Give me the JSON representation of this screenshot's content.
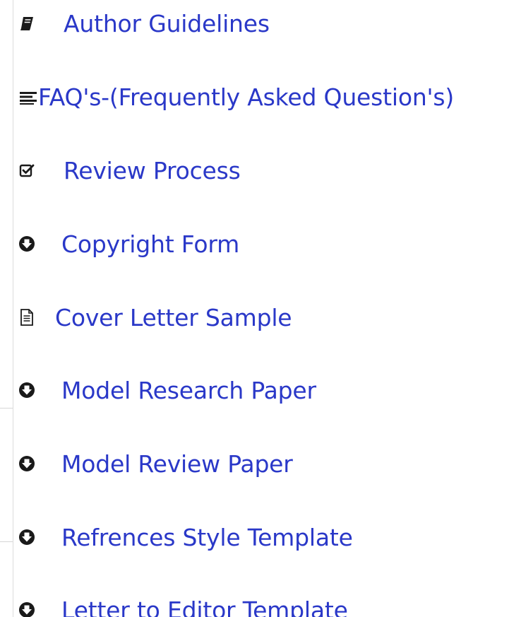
{
  "menu": {
    "items": [
      {
        "label": "Author Guidelines",
        "icon": "book-icon"
      },
      {
        "label": "FAQ's-(Frequently Asked Question's)",
        "icon": "list-lines-icon"
      },
      {
        "label": "Review Process",
        "icon": "checkbox-checked-icon"
      },
      {
        "label": "Copyright Form",
        "icon": "download-circle-icon"
      },
      {
        "label": "Cover Letter Sample",
        "icon": "document-icon"
      },
      {
        "label": "Model Research Paper",
        "icon": "download-circle-icon"
      },
      {
        "label": "Model Review Paper",
        "icon": "download-circle-icon"
      },
      {
        "label": "Refrences Style Template",
        "icon": "download-circle-icon"
      },
      {
        "label": "Letter to Editor Template",
        "icon": "download-circle-icon"
      }
    ],
    "link_color": "#2a38c8",
    "icon_color": "#1a1a1a"
  }
}
